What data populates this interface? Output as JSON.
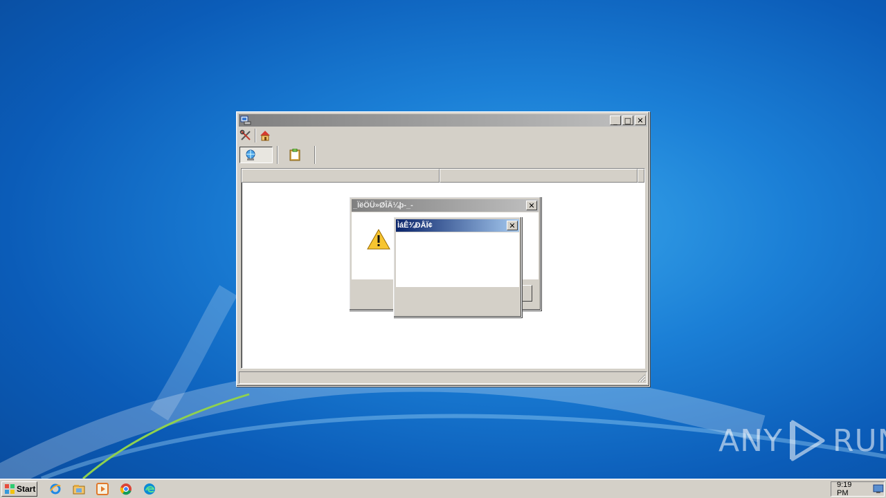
{
  "desktop": {
    "wallpaper": "Windows 7 blue"
  },
  "main_window": {
    "title": "",
    "icon": "computer-network-icon",
    "menu_icons": [
      "tools-icon",
      "home-icon"
    ],
    "toolbar_icons": [
      "globe-network-icon",
      "clipboard-icon"
    ],
    "list_columns": [
      "",
      ""
    ],
    "status_text": ""
  },
  "dialog1": {
    "title": "_ÏëÖÜ»ØÎÄ¼þ-_-",
    "icon": "warning-icon",
    "message": "",
    "button_label": ""
  },
  "dialog2": {
    "title": "ÌáÊ¾ÐÅÏ¢",
    "message": ""
  },
  "watermark": {
    "text_left": "ANY",
    "text_right": "RUN"
  },
  "taskbar": {
    "start_label": "Start",
    "quick_launch": [
      "internet-explorer-icon",
      "explorer-folder-icon",
      "media-player-icon",
      "chrome-icon",
      "edge-icon"
    ],
    "clock": "9:19 PM"
  },
  "colors": {
    "accent_active": "#0a246a",
    "inactive_title": "#808080"
  }
}
